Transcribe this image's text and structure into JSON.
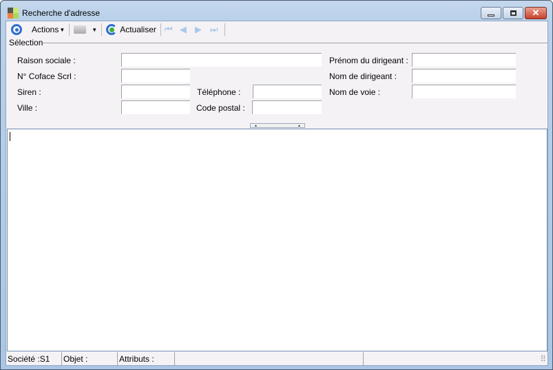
{
  "window": {
    "title": "Recherche d'adresse"
  },
  "toolbar": {
    "actions_label": "Actions",
    "refresh_label": "Actualiser"
  },
  "selection": {
    "title": "Sélection",
    "fields": {
      "raison_sociale": {
        "label": "Raison sociale :",
        "value": ""
      },
      "coface": {
        "label": "N° Coface Scrl :",
        "value": ""
      },
      "siren": {
        "label": "Siren :",
        "value": ""
      },
      "ville": {
        "label": "Ville :",
        "value": ""
      },
      "telephone": {
        "label": "Téléphone :",
        "value": ""
      },
      "code_postal": {
        "label": "Code postal :",
        "value": ""
      },
      "prenom": {
        "label": "Prénom du dirigeant :",
        "value": ""
      },
      "nom": {
        "label": "Nom de dirigeant :",
        "value": ""
      },
      "voie": {
        "label": "Nom de voie :",
        "value": ""
      }
    }
  },
  "status": {
    "societe": "Société :S1",
    "objet": "Objet :",
    "attributs": "Attributs :"
  }
}
